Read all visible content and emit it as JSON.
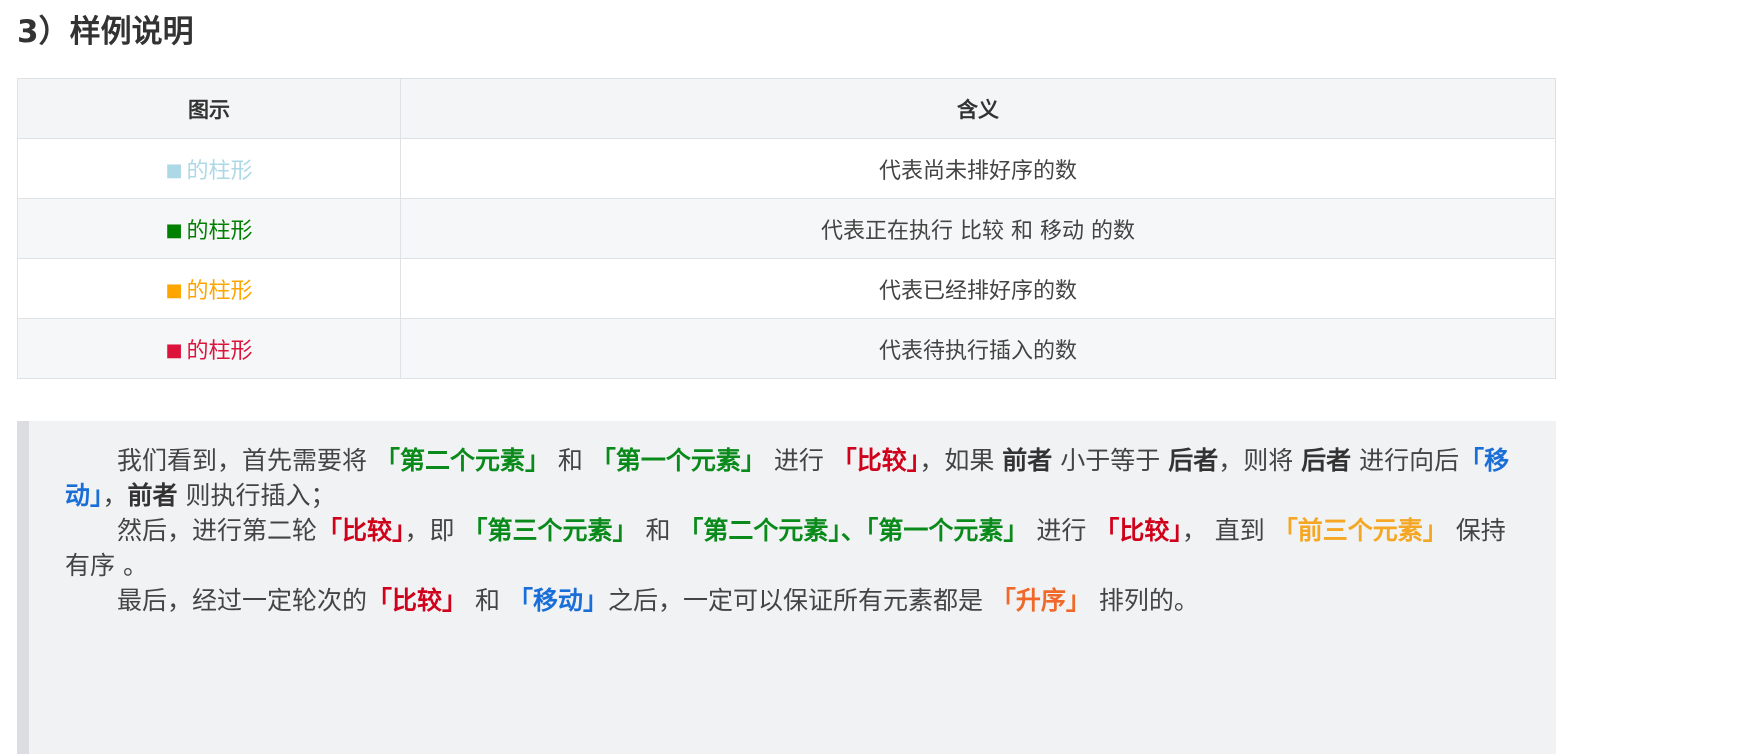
{
  "heading": "3）样例说明",
  "table": {
    "headers": [
      "图示",
      "含义"
    ],
    "rows": [
      {
        "square": "■",
        "label": "的柱形",
        "color": "#add8e6",
        "meaning": "代表尚未排好序的数"
      },
      {
        "square": "■",
        "label": "的柱形",
        "color": "#008000",
        "meaning": "代表正在执行 比较 和 移动 的数"
      },
      {
        "square": "■",
        "label": "的柱形",
        "color": "#ffa500",
        "meaning": "代表已经排好序的数"
      },
      {
        "square": "■",
        "label": "的柱形",
        "color": "#dc143c",
        "meaning": "代表待执行插入的数"
      }
    ]
  },
  "paragraphs": {
    "p1": {
      "t1": "我们看到，首先需要将 ",
      "h1": "「第二个元素」",
      "t2": " 和 ",
      "h2": "「第一个元素」",
      "t3": " 进行 ",
      "h3": "「比较」",
      "t4": "，如果 ",
      "h4": "前者",
      "t5": " 小于等于 ",
      "h5": "后者",
      "t6": "，则将 ",
      "h6": "后者",
      "t7": " 进行向后",
      "h7": "「移动」",
      "t8": "，",
      "h8": "前者",
      "t9": " 则执行插入；"
    },
    "p2": {
      "t1": "然后，进行第二轮",
      "h1": "「比较」",
      "t2": "，即 ",
      "h2": "「第三个元素」",
      "t3": " 和 ",
      "h3": "「第二个元素」、「第一个元素」",
      "t4": " 进行 ",
      "h4": "「比较」",
      "t5": "， 直到 ",
      "h5": "「前三个元素」",
      "t6": " 保持有序 。"
    },
    "p3": {
      "t1": "最后，经过一定轮次的",
      "h1": "「比较」",
      "t2": " 和 ",
      "h2": "「移动」",
      "t3": "之后，一定可以保证所有元素都是 ",
      "h3": "「升序」",
      "t4": " 排列的。"
    }
  }
}
